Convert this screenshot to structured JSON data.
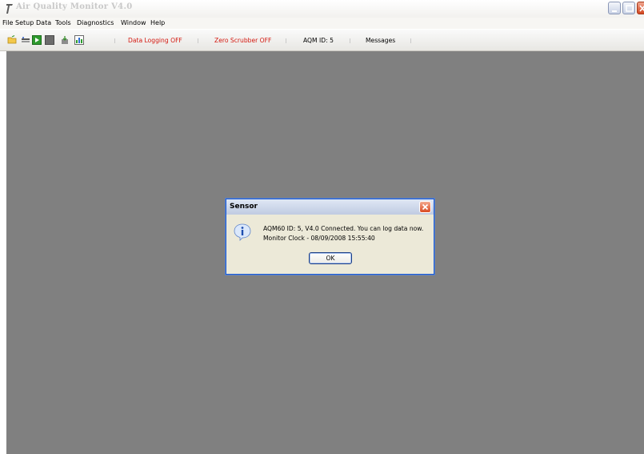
{
  "window": {
    "title": "Air Quality Monitor V4.0",
    "icons": {
      "app": "app-feather-icon",
      "minimize": "minimize-icon",
      "maximize": "maximize-icon",
      "close": "close-icon"
    }
  },
  "menubar": {
    "items": [
      "File",
      "Setup",
      "Data",
      "Tools",
      "Diagnostics",
      "Window",
      "Help"
    ]
  },
  "toolbar": {
    "icons": [
      "open-folder-icon",
      "connect-icon",
      "start-logging-icon",
      "stop-logging-icon",
      "download-icon",
      "chart-icon"
    ],
    "status": {
      "data_logging": "Data Logging OFF",
      "zero_scrubber": "Zero Scrubber OFF",
      "aqm_id": "AQM ID: 5",
      "messages": "Messages"
    },
    "colors": {
      "alert": "#d4180f"
    }
  },
  "client_area": {
    "background": "#808080"
  },
  "dialog": {
    "title": "Sensor",
    "icon": "information-icon",
    "message_line1": "AQM60 ID: 5, V4.0 Connected. You can log data now.",
    "message_line2": "Monitor Clock - 08/09/2008 15:55:40",
    "ok_label": "OK"
  }
}
